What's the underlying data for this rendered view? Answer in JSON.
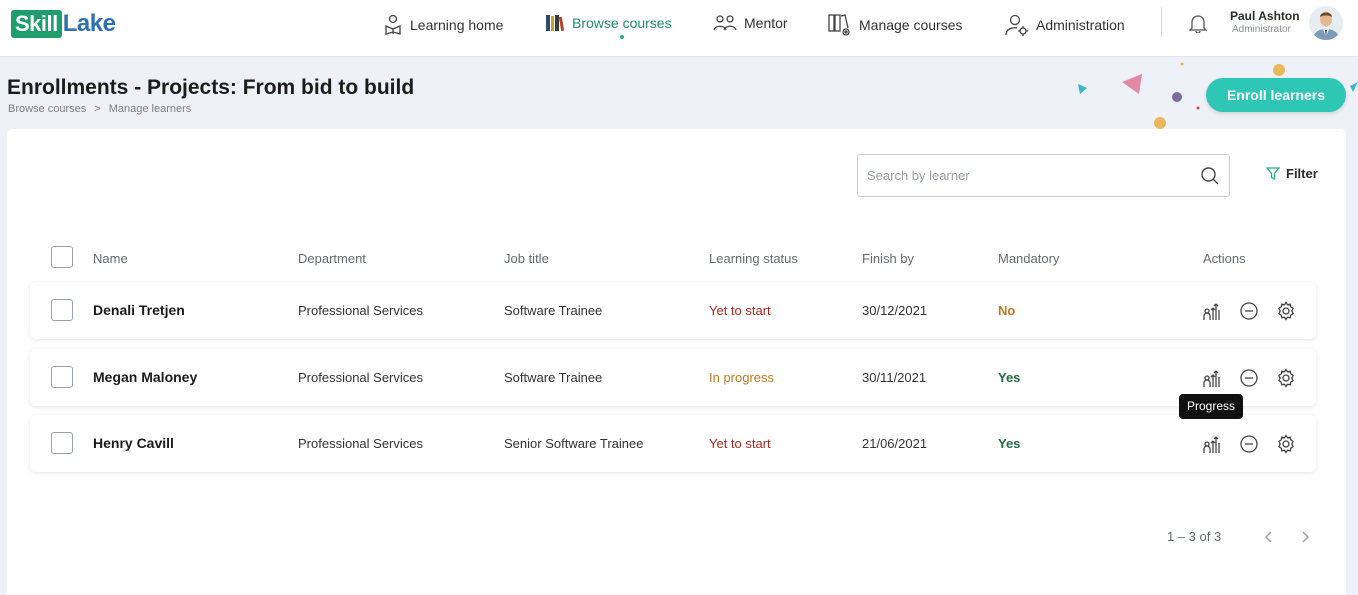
{
  "brand": {
    "part1": "Skill",
    "part2": "Lake"
  },
  "nav": {
    "learning_home": "Learning home",
    "browse_courses": "Browse courses",
    "mentor": "Mentor",
    "manage_courses": "Manage courses",
    "administration": "Administration"
  },
  "user": {
    "name": "Paul Ashton",
    "role": "Administrator"
  },
  "page": {
    "title": "Enrollments - Projects: From bid to build",
    "breadcrumb": [
      "Browse courses",
      ">",
      "Manage learners"
    ],
    "enroll_button": "Enroll learners"
  },
  "search": {
    "placeholder": "Search by learner"
  },
  "filter_label": "Filter",
  "table": {
    "headers": {
      "name": "Name",
      "department": "Department",
      "job_title": "Job title",
      "learning_status": "Learning status",
      "finish_by": "Finish by",
      "mandatory": "Mandatory",
      "actions": "Actions"
    },
    "rows": [
      {
        "name": "Denali Tretjen",
        "department": "Professional Services",
        "job_title": "Software Trainee",
        "status": "Yet to start",
        "finish_by": "30/12/2021",
        "mandatory": "No"
      },
      {
        "name": "Megan Maloney",
        "department": "Professional Services",
        "job_title": "Software Trainee",
        "status": "In progress",
        "finish_by": "30/11/2021",
        "mandatory": "Yes"
      },
      {
        "name": "Henry Cavill",
        "department": "Professional Services",
        "job_title": "Senior Software Trainee",
        "status": "Yet to start",
        "finish_by": "21/06/2021",
        "mandatory": "Yes"
      }
    ]
  },
  "tooltip": "Progress",
  "pagination": "1 – 3 of 3",
  "colors": {
    "brand_green": "#1d9e6c",
    "brand_blue": "#2d6fb0",
    "accent_teal": "#2ec6b5",
    "status_red": "#b0281e",
    "status_orange": "#c07b22",
    "yes_green": "#236b41"
  }
}
